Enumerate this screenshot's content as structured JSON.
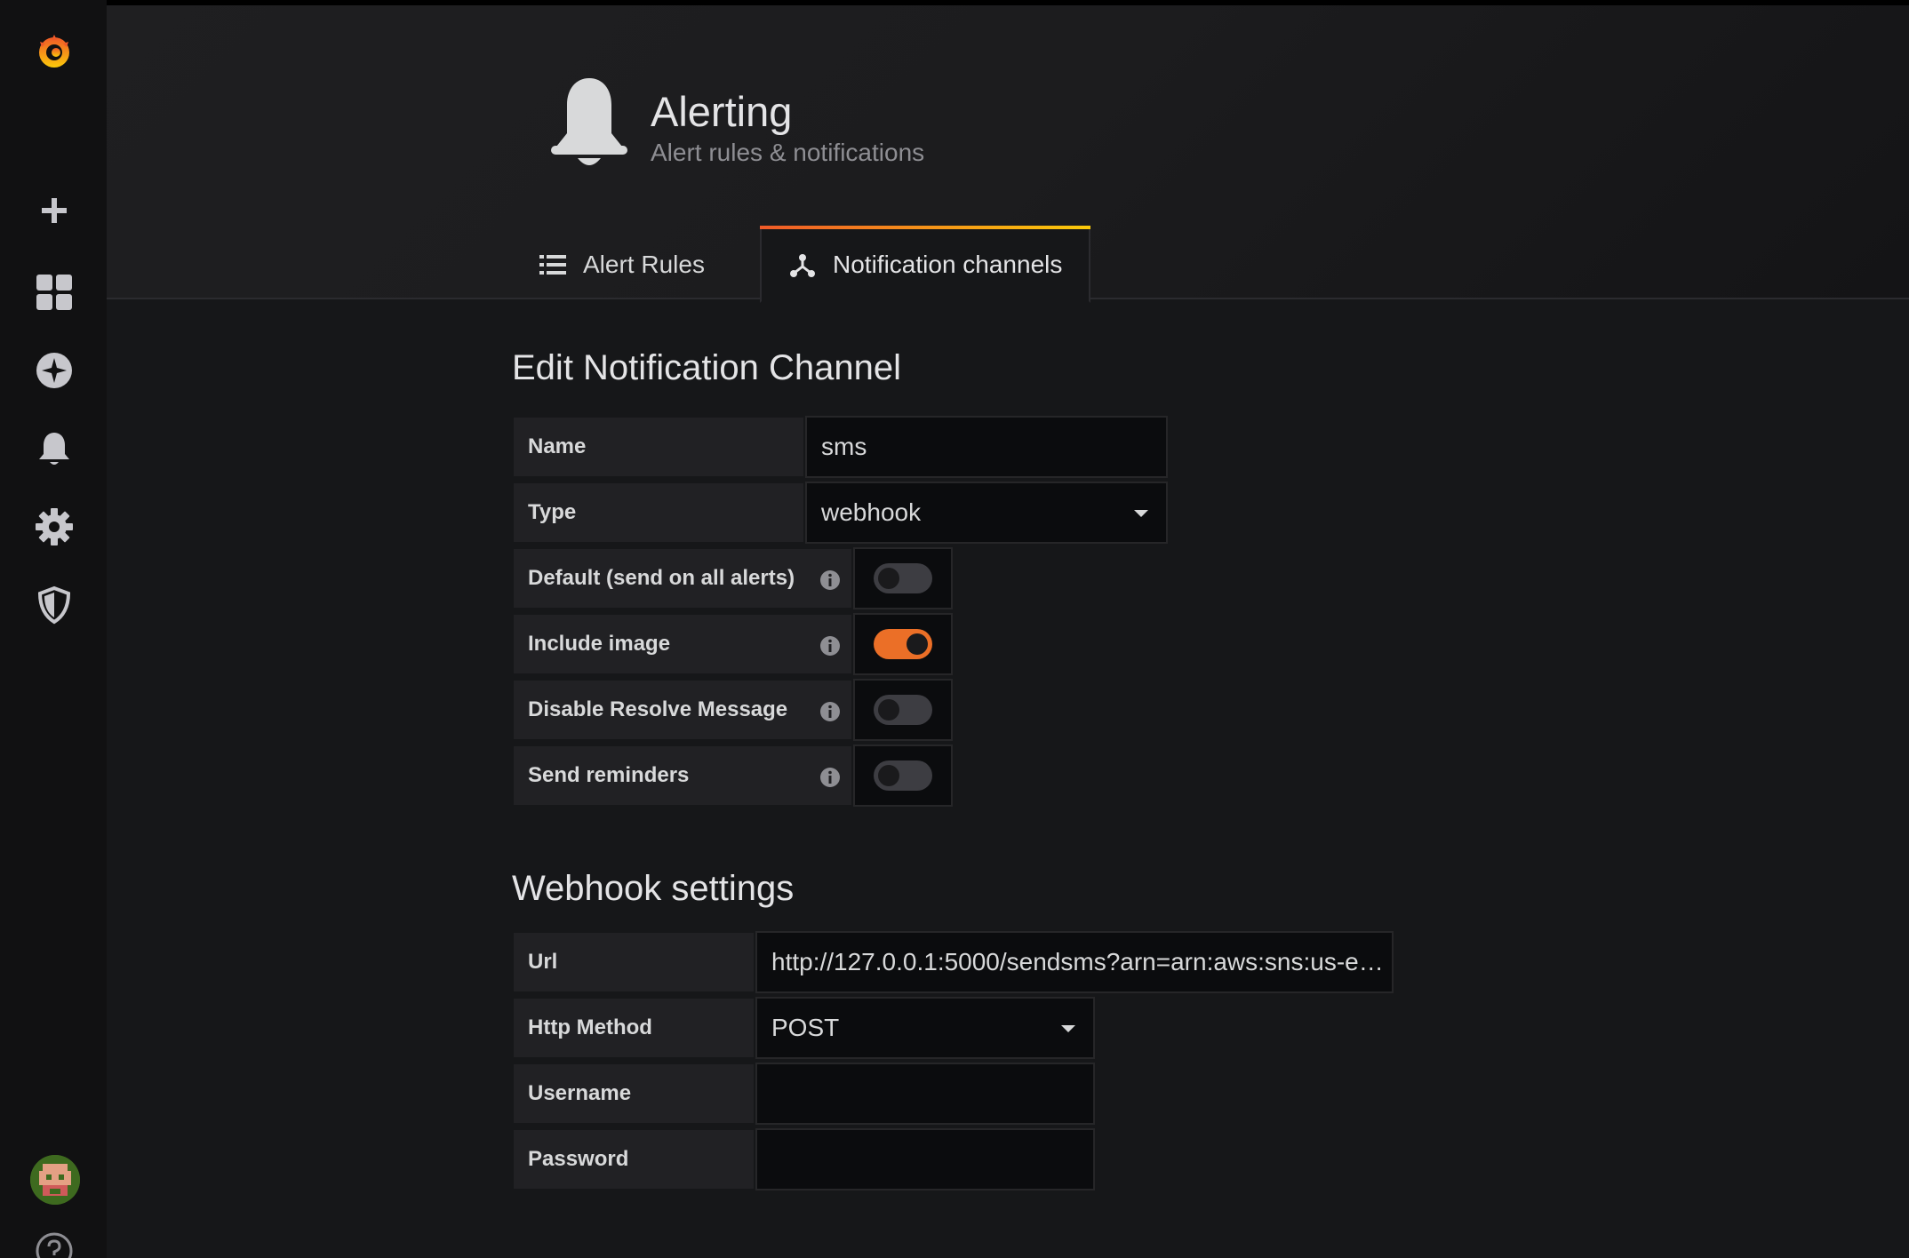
{
  "header": {
    "title": "Alerting",
    "subtitle": "Alert rules & notifications"
  },
  "tabs": [
    {
      "label": "Alert Rules",
      "icon": "list-icon",
      "active": false
    },
    {
      "label": "Notification channels",
      "icon": "share-nodes-icon",
      "active": true
    }
  ],
  "sidebar": {
    "items": [
      {
        "icon": "grafana-logo-icon"
      },
      {
        "icon": "plus-icon"
      },
      {
        "icon": "dashboards-icon"
      },
      {
        "icon": "explore-compass-icon"
      },
      {
        "icon": "bell-icon"
      },
      {
        "icon": "gear-icon"
      },
      {
        "icon": "shield-icon"
      },
      {
        "icon": "avatar"
      },
      {
        "icon": "help-icon"
      }
    ]
  },
  "form": {
    "title": "Edit Notification Channel",
    "name_label": "Name",
    "name_value": "sms",
    "type_label": "Type",
    "type_value": "webhook",
    "toggles": [
      {
        "label": "Default (send on all alerts)",
        "on": false
      },
      {
        "label": "Include image",
        "on": true
      },
      {
        "label": "Disable Resolve Message",
        "on": false
      },
      {
        "label": "Send reminders",
        "on": false
      }
    ]
  },
  "webhook": {
    "title": "Webhook settings",
    "url_label": "Url",
    "url_value": "http://127.0.0.1:5000/sendsms?arn=arn:aws:sns:us-e…",
    "method_label": "Http Method",
    "method_value": "POST",
    "username_label": "Username",
    "username_value": "",
    "password_label": "Password",
    "password_value": ""
  },
  "colors": {
    "accent": "#eb6f27",
    "background": "#161719",
    "sidebar": "#111112"
  }
}
